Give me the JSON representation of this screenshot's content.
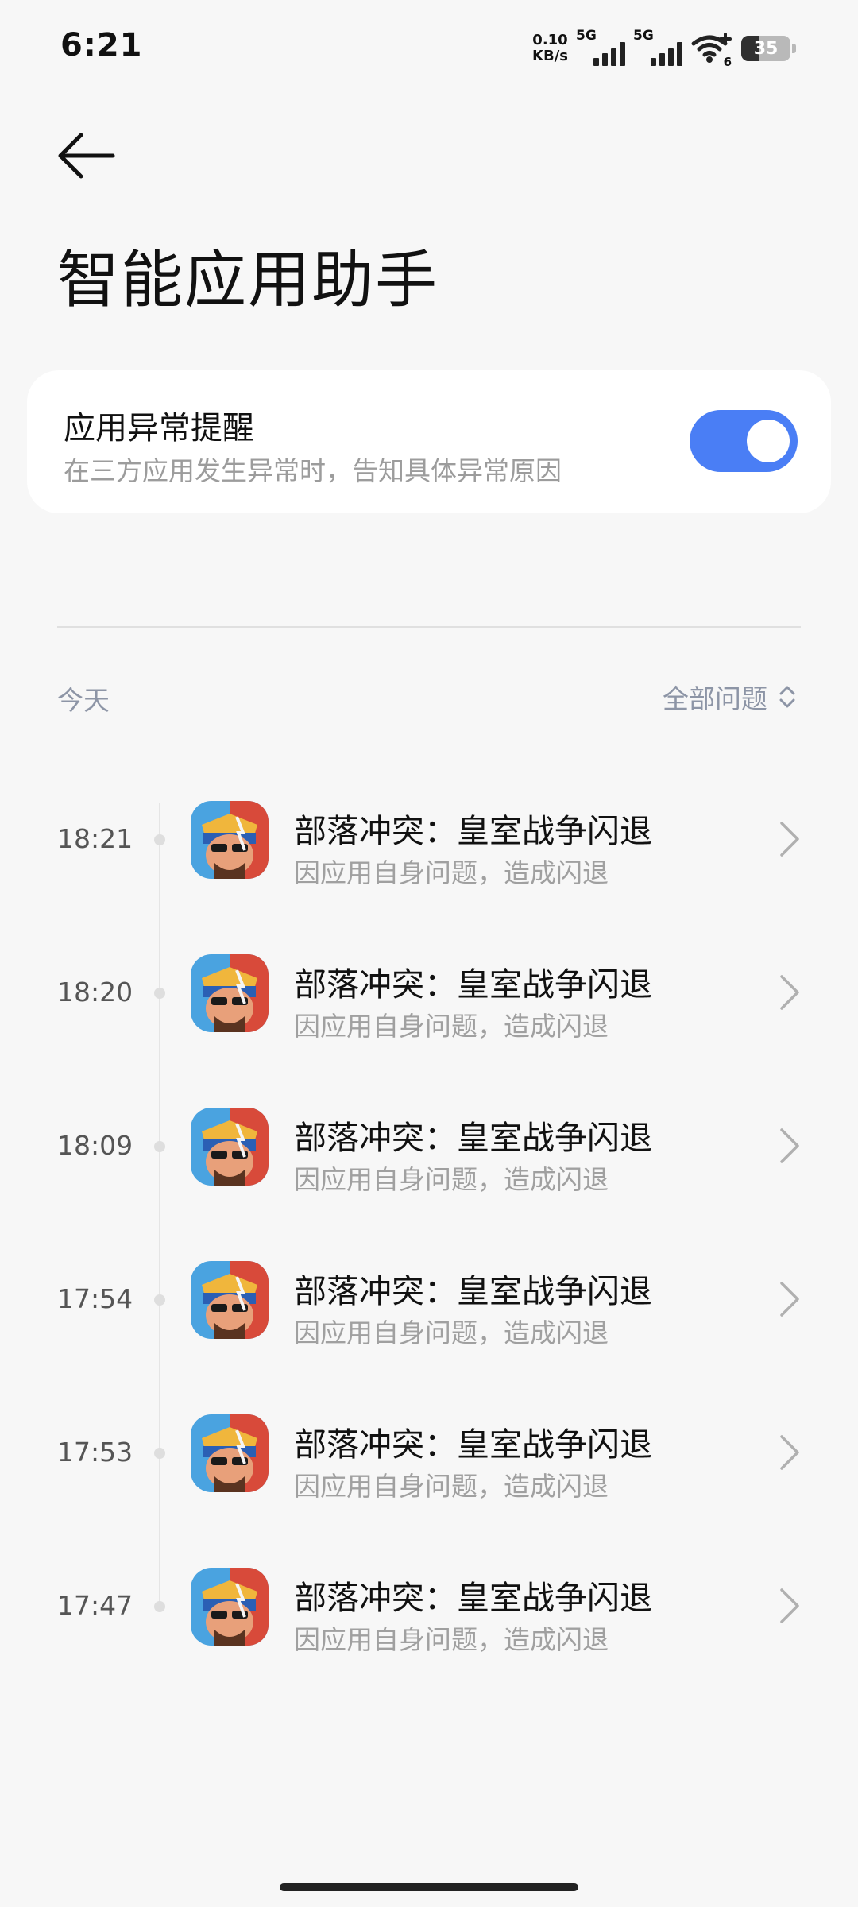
{
  "status_bar": {
    "time": "6:21",
    "net_speed_value": "0.10",
    "net_speed_unit": "KB/s",
    "sim1_label": "5G",
    "sim2_label": "5G",
    "wifi_badge": "6",
    "battery_level": "35",
    "battery_fraction": 0.35
  },
  "header": {
    "back_icon": "arrow-left-icon",
    "title": "智能应用助手"
  },
  "setting_card": {
    "title": "应用异常提醒",
    "subtitle": "在三方应用发生异常时，告知具体异常原因",
    "toggle_on": true,
    "toggle_color": "#4a7ef5"
  },
  "filter": {
    "section_label": "今天",
    "filter_label": "全部问题",
    "filter_icon": "up-down-chevron-icon"
  },
  "events": [
    {
      "time": "18:21",
      "title": "部落冲突：皇室战争闪退",
      "subtitle": "因应用自身问题，造成闪退",
      "icon": "clash-royale-app-icon"
    },
    {
      "time": "18:20",
      "title": "部落冲突：皇室战争闪退",
      "subtitle": "因应用自身问题，造成闪退",
      "icon": "clash-royale-app-icon"
    },
    {
      "time": "18:09",
      "title": "部落冲突：皇室战争闪退",
      "subtitle": "因应用自身问题，造成闪退",
      "icon": "clash-royale-app-icon"
    },
    {
      "time": "17:54",
      "title": "部落冲突：皇室战争闪退",
      "subtitle": "因应用自身问题，造成闪退",
      "icon": "clash-royale-app-icon"
    },
    {
      "time": "17:53",
      "title": "部落冲突：皇室战争闪退",
      "subtitle": "因应用自身问题，造成闪退",
      "icon": "clash-royale-app-icon"
    },
    {
      "time": "17:47",
      "title": "部落冲突：皇室战争闪退",
      "subtitle": "因应用自身问题，造成闪退",
      "icon": "clash-royale-app-icon"
    }
  ]
}
